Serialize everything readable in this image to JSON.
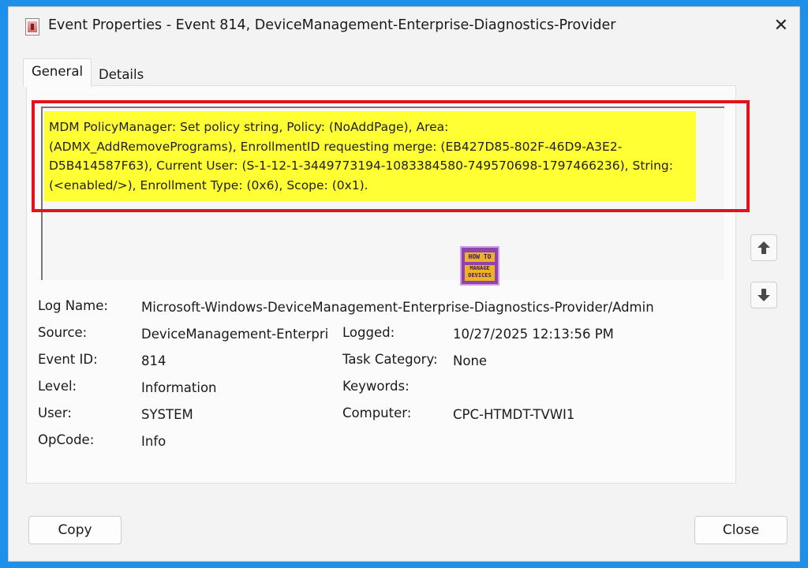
{
  "window": {
    "title": "Event Properties - Event 814, DeviceManagement-Enterprise-Diagnostics-Provider",
    "close_glyph": "✕"
  },
  "tabs": [
    {
      "label": "General",
      "active": true
    },
    {
      "label": "Details",
      "active": false
    }
  ],
  "message": {
    "lines": [
      "MDM PolicyManager: Set policy string, Policy: (NoAddPage), Area:",
      "(ADMX_AddRemovePrograms), EnrollmentID requesting merge: (EB427D85-802F-46D9-A3E2-",
      "D5B414587F63), Current User: (S-1-12-1-3449773194-1083384580-749570698-1797466236), String:",
      "(<enabled/>), Enrollment Type: (0x6), Scope: (0x1)."
    ],
    "highlight_color": "#ffff34",
    "annotation_color": "#e4121c"
  },
  "logo": {
    "top_text": "HOW TO",
    "bottom_line1": "MANAGE",
    "bottom_line2": "DEVICES"
  },
  "fields": {
    "log_name_label": "Log Name:",
    "log_name_value": "Microsoft-Windows-DeviceManagement-Enterprise-Diagnostics-Provider/Admin",
    "source_label": "Source:",
    "source_value": "DeviceManagement-Enterpri",
    "logged_label": "Logged:",
    "logged_value": "10/27/2025 12:13:56 PM",
    "event_id_label": "Event ID:",
    "event_id_value": "814",
    "task_category_label": "Task Category:",
    "task_category_value": "None",
    "level_label": "Level:",
    "level_value": "Information",
    "keywords_label": "Keywords:",
    "keywords_value": "",
    "user_label": "User:",
    "user_value": "SYSTEM",
    "computer_label": "Computer:",
    "computer_value": "CPC-HTMDT-TVWI1",
    "opcode_label": "OpCode:",
    "opcode_value": "Info"
  },
  "buttons": {
    "copy": "Copy",
    "close": "Close"
  },
  "icons": {
    "scroll_up": "arrow-up-icon",
    "scroll_down": "arrow-down-icon"
  }
}
